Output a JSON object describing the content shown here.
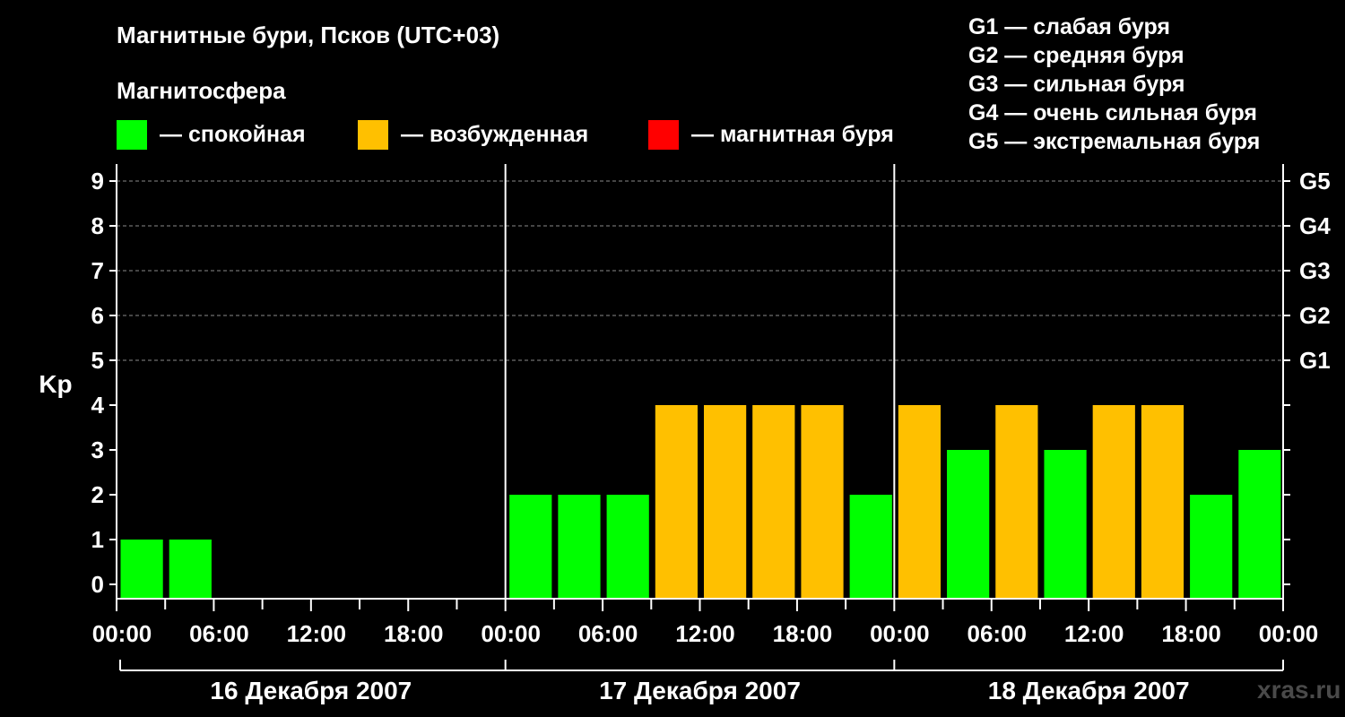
{
  "header": {
    "title": "Магнитные бури, Псков (UTC+03)",
    "subtitle": "Магнитосфера"
  },
  "legend": [
    {
      "label": "— спокойная",
      "color": "#00ff00"
    },
    {
      "label": "— возбужденная",
      "color": "#ffc000"
    },
    {
      "label": "— магнитная буря",
      "color": "#ff0000"
    }
  ],
  "g_scale": [
    "G1 — слабая буря",
    "G2 — средняя буря",
    "G3 — сильная буря",
    "G4 — очень сильная буря",
    "G5 — экстремальная буря"
  ],
  "watermark": "xras.ru",
  "chart_data": {
    "type": "bar",
    "ylabel": "Kp",
    "ylim": [
      0,
      9
    ],
    "yticks": [
      "0",
      "1",
      "2",
      "3",
      "4",
      "5",
      "6",
      "7",
      "8",
      "9"
    ],
    "right_labels": [
      {
        "label": "G1",
        "kp": 5
      },
      {
        "label": "G2",
        "kp": 6
      },
      {
        "label": "G3",
        "kp": 7
      },
      {
        "label": "G4",
        "kp": 8
      },
      {
        "label": "G5",
        "kp": 9
      }
    ],
    "grid": "dashed horizontal at Kp 5-9",
    "interval_hours": 3,
    "xtick_labels": [
      "00:00",
      "06:00",
      "12:00",
      "18:00",
      "00:00",
      "06:00",
      "12:00",
      "18:00",
      "00:00",
      "06:00",
      "12:00",
      "18:00",
      "00:00"
    ],
    "days": [
      {
        "label": "16 Декабря 2007",
        "values": [
          1,
          1,
          null,
          null,
          null,
          null,
          null,
          null
        ]
      },
      {
        "label": "17 Декабря 2007",
        "values": [
          2,
          2,
          2,
          4,
          4,
          4,
          4,
          2
        ]
      },
      {
        "label": "18 Декабря 2007",
        "values": [
          4,
          3,
          4,
          3,
          4,
          4,
          2,
          3
        ]
      }
    ],
    "colors": {
      "quiet": "#00ff00",
      "active": "#ffc000",
      "storm": "#ff0000"
    }
  }
}
